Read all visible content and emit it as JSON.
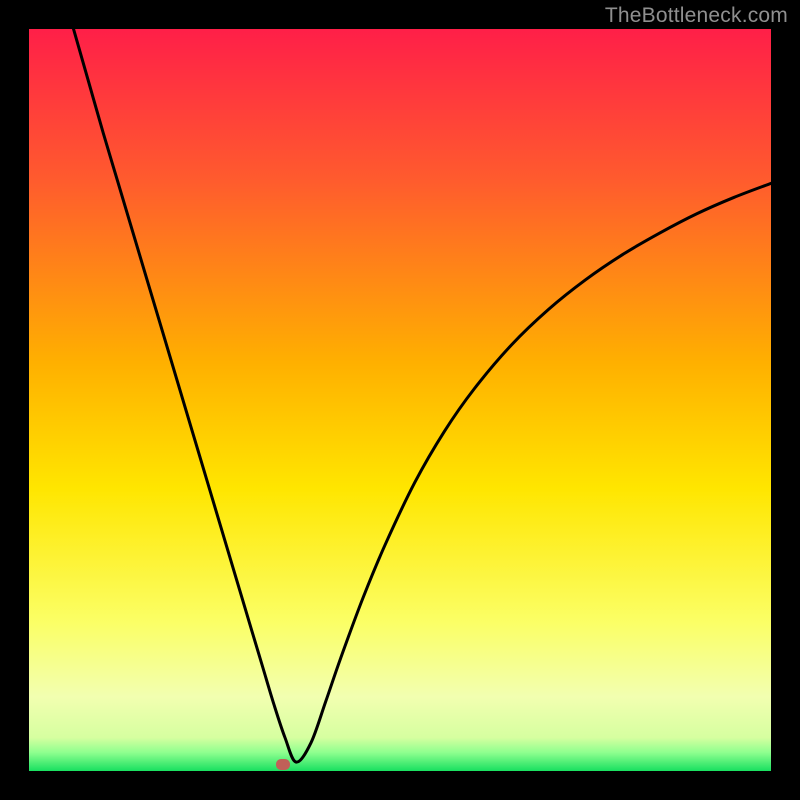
{
  "watermark": {
    "text": "TheBottleneck.com"
  },
  "chart_data": {
    "type": "line",
    "title": "",
    "xlabel": "",
    "ylabel": "",
    "xlim": [
      0,
      100
    ],
    "ylim": [
      0,
      100
    ],
    "grid": false,
    "legend": false,
    "gradient_stops": [
      {
        "offset": 0,
        "color": "#ff1f48"
      },
      {
        "offset": 0.2,
        "color": "#ff5a2e"
      },
      {
        "offset": 0.45,
        "color": "#ffb000"
      },
      {
        "offset": 0.62,
        "color": "#ffe600"
      },
      {
        "offset": 0.8,
        "color": "#fbff66"
      },
      {
        "offset": 0.9,
        "color": "#f2ffb0"
      },
      {
        "offset": 0.955,
        "color": "#d6ffa0"
      },
      {
        "offset": 0.975,
        "color": "#8fff8f"
      },
      {
        "offset": 1.0,
        "color": "#18e060"
      }
    ],
    "series": [
      {
        "name": "bottleneck-curve",
        "x": [
          6,
          8,
          10,
          12,
          14,
          16,
          18,
          20,
          22,
          24,
          26,
          28,
          30,
          31.5,
          33,
          34.5,
          36,
          38,
          40,
          42,
          45,
          48,
          52,
          56,
          60,
          65,
          70,
          75,
          80,
          85,
          90,
          95,
          100
        ],
        "y": [
          100,
          93,
          86,
          79.3,
          72.6,
          65.9,
          59.2,
          52.5,
          45.8,
          39.1,
          32.4,
          25.7,
          19,
          14,
          9,
          4.5,
          1.2,
          3.8,
          9.4,
          15.2,
          23.3,
          30.5,
          38.9,
          45.8,
          51.5,
          57.4,
          62.2,
          66.2,
          69.6,
          72.5,
          75.1,
          77.3,
          79.2
        ]
      }
    ],
    "marker": {
      "x": 34.2,
      "y": 1.0,
      "color": "#c06058"
    }
  }
}
